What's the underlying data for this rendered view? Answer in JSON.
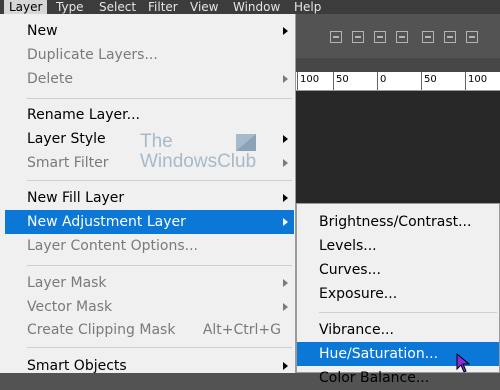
{
  "menubar": {
    "items": [
      "Layer",
      "Type",
      "Select",
      "Filter",
      "View",
      "Window",
      "Help"
    ]
  },
  "ruler": {
    "ticks": [
      "100",
      "50",
      "0",
      "50",
      "100"
    ]
  },
  "watermark": {
    "line1": "The",
    "line2": "WindowsClub"
  },
  "layer_menu": {
    "items": [
      {
        "label": "New",
        "submenu": true,
        "enabled": true
      },
      {
        "label": "Duplicate Layers...",
        "enabled": false
      },
      {
        "label": "Delete",
        "submenu": true,
        "enabled": false
      },
      {
        "label": "Rename Layer...",
        "enabled": true
      },
      {
        "label": "Layer Style",
        "submenu": true,
        "enabled": true
      },
      {
        "label": "Smart Filter",
        "submenu": true,
        "enabled": false
      },
      {
        "label": "New Fill Layer",
        "submenu": true,
        "enabled": true
      },
      {
        "label": "New Adjustment Layer",
        "submenu": true,
        "enabled": true,
        "highlighted": true
      },
      {
        "label": "Layer Content Options...",
        "enabled": false
      },
      {
        "label": "Layer Mask",
        "submenu": true,
        "enabled": false
      },
      {
        "label": "Vector Mask",
        "submenu": true,
        "enabled": false
      },
      {
        "label": "Create Clipping Mask",
        "shortcut": "Alt+Ctrl+G",
        "enabled": false
      },
      {
        "label": "Smart Objects",
        "submenu": true,
        "enabled": true
      }
    ]
  },
  "adjustment_submenu": {
    "items": [
      {
        "label": "Brightness/Contrast..."
      },
      {
        "label": "Levels..."
      },
      {
        "label": "Curves..."
      },
      {
        "label": "Exposure..."
      },
      {
        "label": "Vibrance..."
      },
      {
        "label": "Hue/Saturation...",
        "highlighted": true
      },
      {
        "label": "Color Balance..."
      }
    ]
  },
  "colors": {
    "accent": "#0b78d7",
    "menu_bg": "#f0f0f0",
    "app_bg": "#535353",
    "menubar_bg": "#3c3c3c"
  }
}
